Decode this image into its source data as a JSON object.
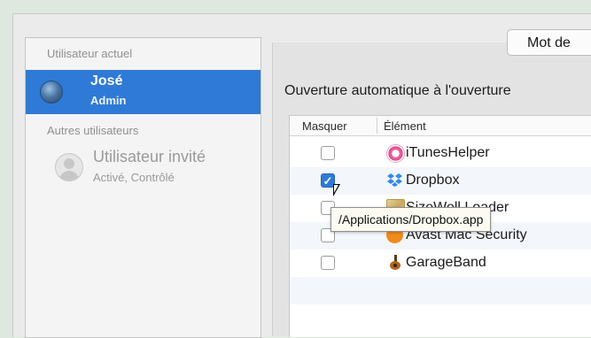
{
  "sidebar": {
    "current_user_label": "Utilisateur actuel",
    "current_user": {
      "name": "José",
      "role": "Admin"
    },
    "other_users_label": "Autres utilisateurs",
    "guest_user": {
      "name": "Utilisateur invité",
      "status": "Activé, Contrôlé"
    }
  },
  "header": {
    "password_tab_label": "Mot de"
  },
  "main": {
    "heading": "Ouverture automatique à l'ouverture",
    "columns": [
      "Masquer",
      "Élément"
    ],
    "items": [
      {
        "name": "iTunesHelper",
        "hidden": false,
        "icon": "itunes-icon"
      },
      {
        "name": "Dropbox",
        "hidden": true,
        "icon": "dropbox-icon"
      },
      {
        "name": "SizeWell Loader",
        "hidden": false,
        "icon": "sizewell-icon"
      },
      {
        "name": "Avast Mac Security",
        "hidden": false,
        "icon": "avast-icon"
      },
      {
        "name": "GarageBand",
        "hidden": false,
        "icon": "garageband-icon"
      }
    ],
    "tooltip": "/Applications/Dropbox.app"
  },
  "colors": {
    "selection": "#2f7ad6",
    "background": "#dfe8de"
  }
}
